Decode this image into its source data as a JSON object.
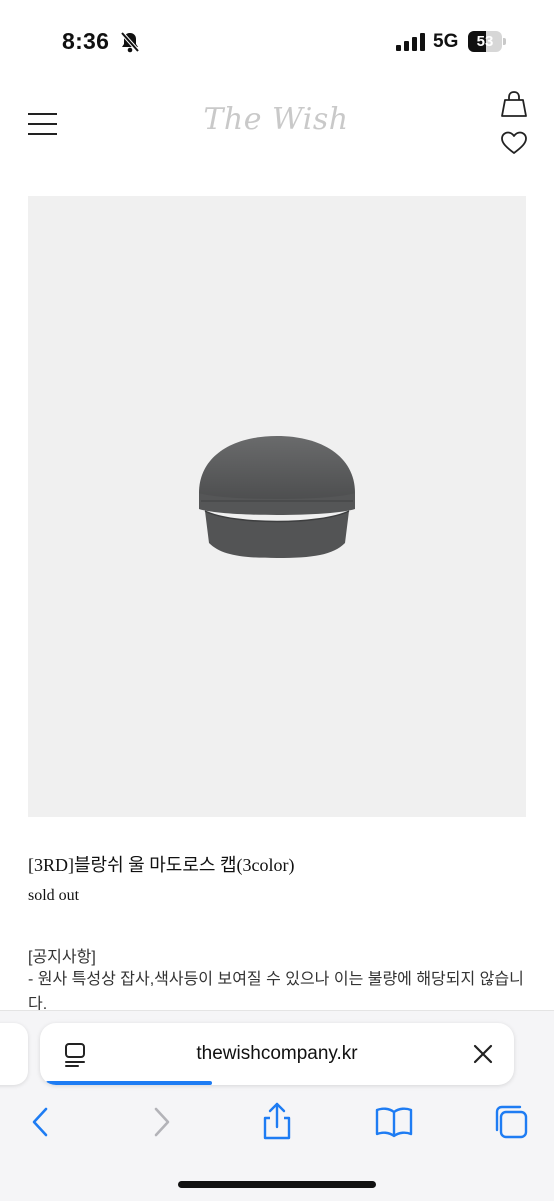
{
  "status_bar": {
    "time": "8:36",
    "network": "5G",
    "battery": "53",
    "battery_level": 0.53
  },
  "header": {
    "logo": "The Wish",
    "icons": [
      "menu-icon",
      "shopping-bag-icon",
      "heart-icon"
    ]
  },
  "product": {
    "name": "[3RD]블랑쉬 울 마도로스 캡(3color)",
    "status": "sold out",
    "image_bg": "#f0f0f0"
  },
  "notice": {
    "title": "[공지사항]",
    "body": "- 원사 특성상 잡사,색사등이 보여질 수 있으나 이는 불량에 해당되지 않습니다."
  },
  "browser": {
    "address": "thewishcompany.kr",
    "load_progress": 0.36,
    "accent": "#1e7cf3",
    "icons": [
      "page-format-icon",
      "close-icon",
      "back-icon",
      "forward-icon",
      "share-icon",
      "bookmarks-icon",
      "tabs-icon"
    ]
  }
}
